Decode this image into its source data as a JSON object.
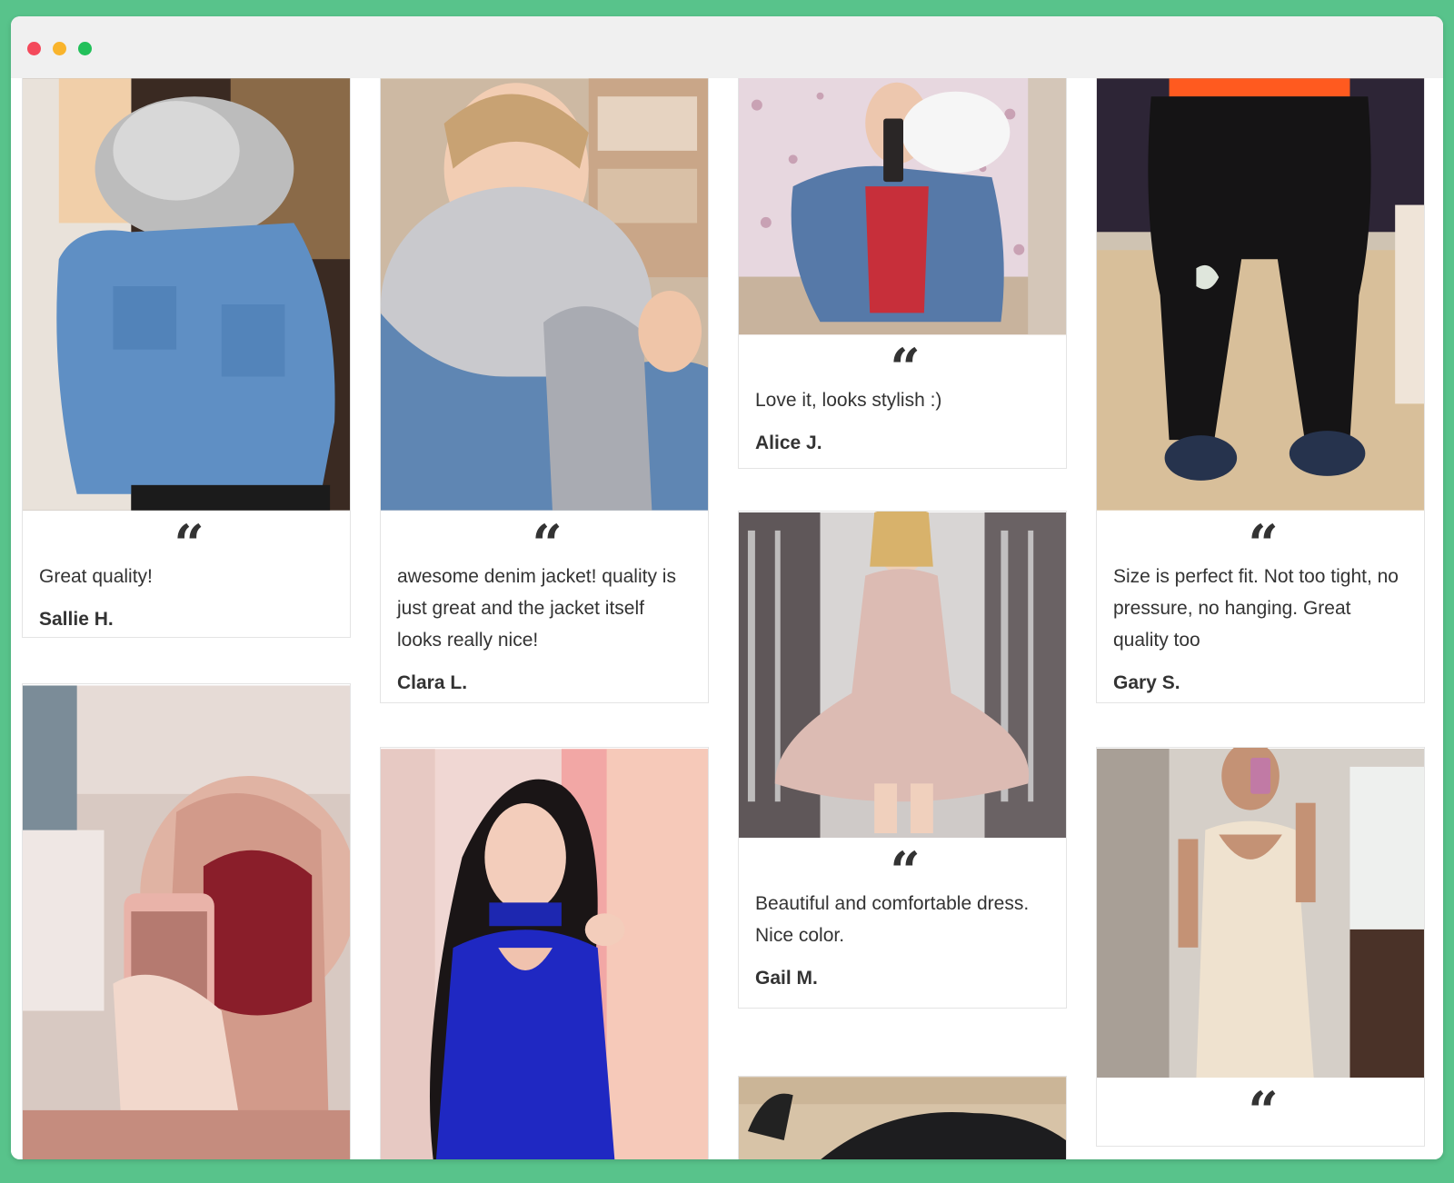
{
  "window": {
    "controls": [
      "close",
      "minimize",
      "maximize"
    ],
    "background_color": "#58c38b"
  },
  "quote_glyph": "“",
  "reviews": [
    {
      "text": "Great quality!",
      "author": "Sallie H.",
      "photo": "woman-denim-jacket-grey-fur-hood"
    },
    {
      "text": "awesome denim jacket! quality is just great and the jacket itself looks really nice!",
      "author": "Clara L.",
      "photo": "woman-selfie-denim-fur-jacket"
    },
    {
      "text": "Love it, looks stylish :)",
      "author": "Alice J.",
      "photo": "mirror-selfie-denim-jacket-white-fur"
    },
    {
      "text": "Size is perfect fit. Not too tight, no pressure, no hanging. Great quality too",
      "author": "Gary S.",
      "photo": "black-ripped-jeans-slippers"
    },
    {
      "text": "",
      "author": "",
      "photo": "mirror-selfie-red-lace-lingerie"
    },
    {
      "text": "",
      "author": "",
      "photo": "woman-blue-choker-dress"
    },
    {
      "text": "Beautiful and comfortable dress. Nice color.",
      "author": "Gail M.",
      "photo": "woman-pink-knit-dress"
    },
    {
      "text": "",
      "author": "",
      "photo": "black-boots-on-wood-floor"
    },
    {
      "text": "",
      "author": "",
      "photo": "mirror-selfie-satin-slip-dress"
    }
  ]
}
